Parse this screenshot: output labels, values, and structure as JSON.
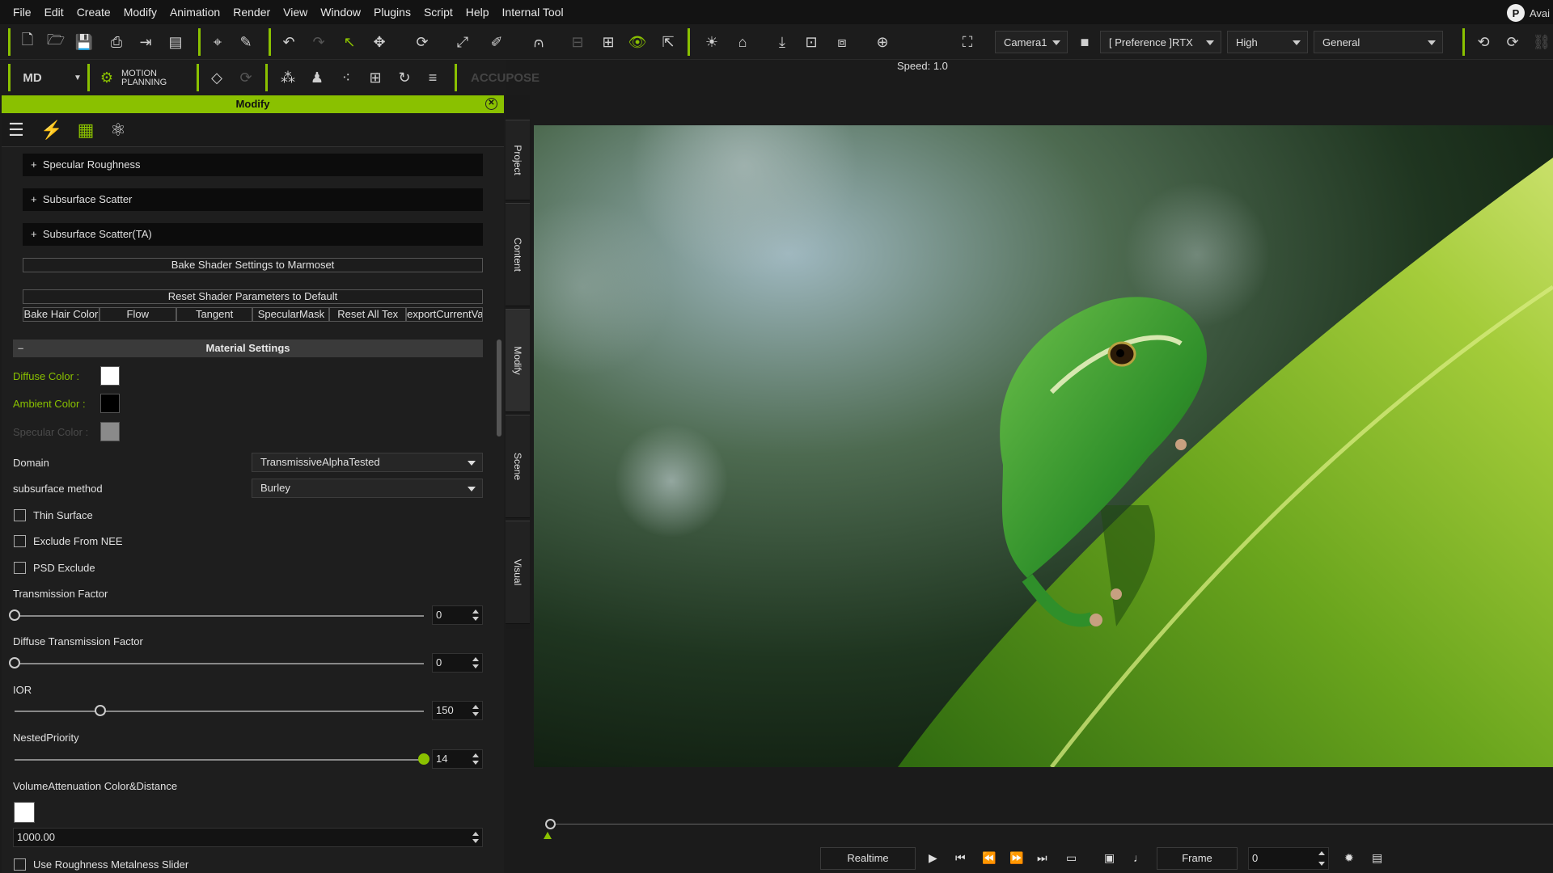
{
  "menu": [
    "File",
    "Edit",
    "Create",
    "Modify",
    "Animation",
    "Render",
    "View",
    "Window",
    "Plugins",
    "Script",
    "Help",
    "Internal Tool"
  ],
  "account": {
    "badge": "P",
    "text": "Avai"
  },
  "toolbar": {
    "speed_label": "Speed: 1.0",
    "camera": "Camera1",
    "preference": "[ Preference ]RTX",
    "quality": "High",
    "mode": "General"
  },
  "toolbar2": {
    "motion_planning": "MOTION PLANNING",
    "accupose": "ACCUPOSE"
  },
  "panel": {
    "title": "Modify",
    "sections": [
      "Specular Roughness",
      "Subsurface Scatter",
      "Subsurface Scatter(TA)"
    ],
    "bake_button": "Bake Shader Settings to Marmoset",
    "reset_button": "Reset Shader Parameters to Default",
    "button_row": [
      "Bake Hair Color",
      "Flow",
      "Tangent",
      "SpecularMask",
      "Reset All Tex",
      "exportCurrentValue"
    ],
    "material_settings": "Material Settings",
    "colors": [
      {
        "label": "Diffuse Color :",
        "swatch": "#ffffff",
        "label_color": "#8ac100"
      },
      {
        "label": "Ambient Color :",
        "swatch": "#000000",
        "label_color": "#8ac100"
      },
      {
        "label": "Specular Color :",
        "swatch": "#8a8a8a",
        "label_color": "#4a4a4a"
      }
    ],
    "domain": {
      "label": "Domain",
      "value": "TransmissiveAlphaTested"
    },
    "subsurface": {
      "label": "subsurface method",
      "value": "Burley"
    },
    "checkboxes": [
      "Thin Surface",
      "Exclude From NEE",
      "PSD Exclude"
    ],
    "sliders": [
      {
        "label": "Transmission Factor",
        "value": "0",
        "fraction": 0
      },
      {
        "label": "Diffuse Transmission Factor",
        "value": "0",
        "fraction": 0
      },
      {
        "label": "IOR",
        "value": "150",
        "fraction": 0.21
      },
      {
        "label": "NestedPriority",
        "value": "14",
        "fraction": 1.0
      }
    ],
    "volume": {
      "label": "VolumeAttenuation Color&Distance",
      "swatch": "#ffffff",
      "distance": "1000.00"
    },
    "last_checkbox": "Use Roughness Metalness Slider"
  },
  "side_tabs": [
    "Project",
    "Content",
    "Modify",
    "Scene",
    "Visual"
  ],
  "playback": {
    "mode": "Realtime",
    "frame_label": "Frame",
    "frame_value": "0"
  },
  "accent": "#8ac100"
}
